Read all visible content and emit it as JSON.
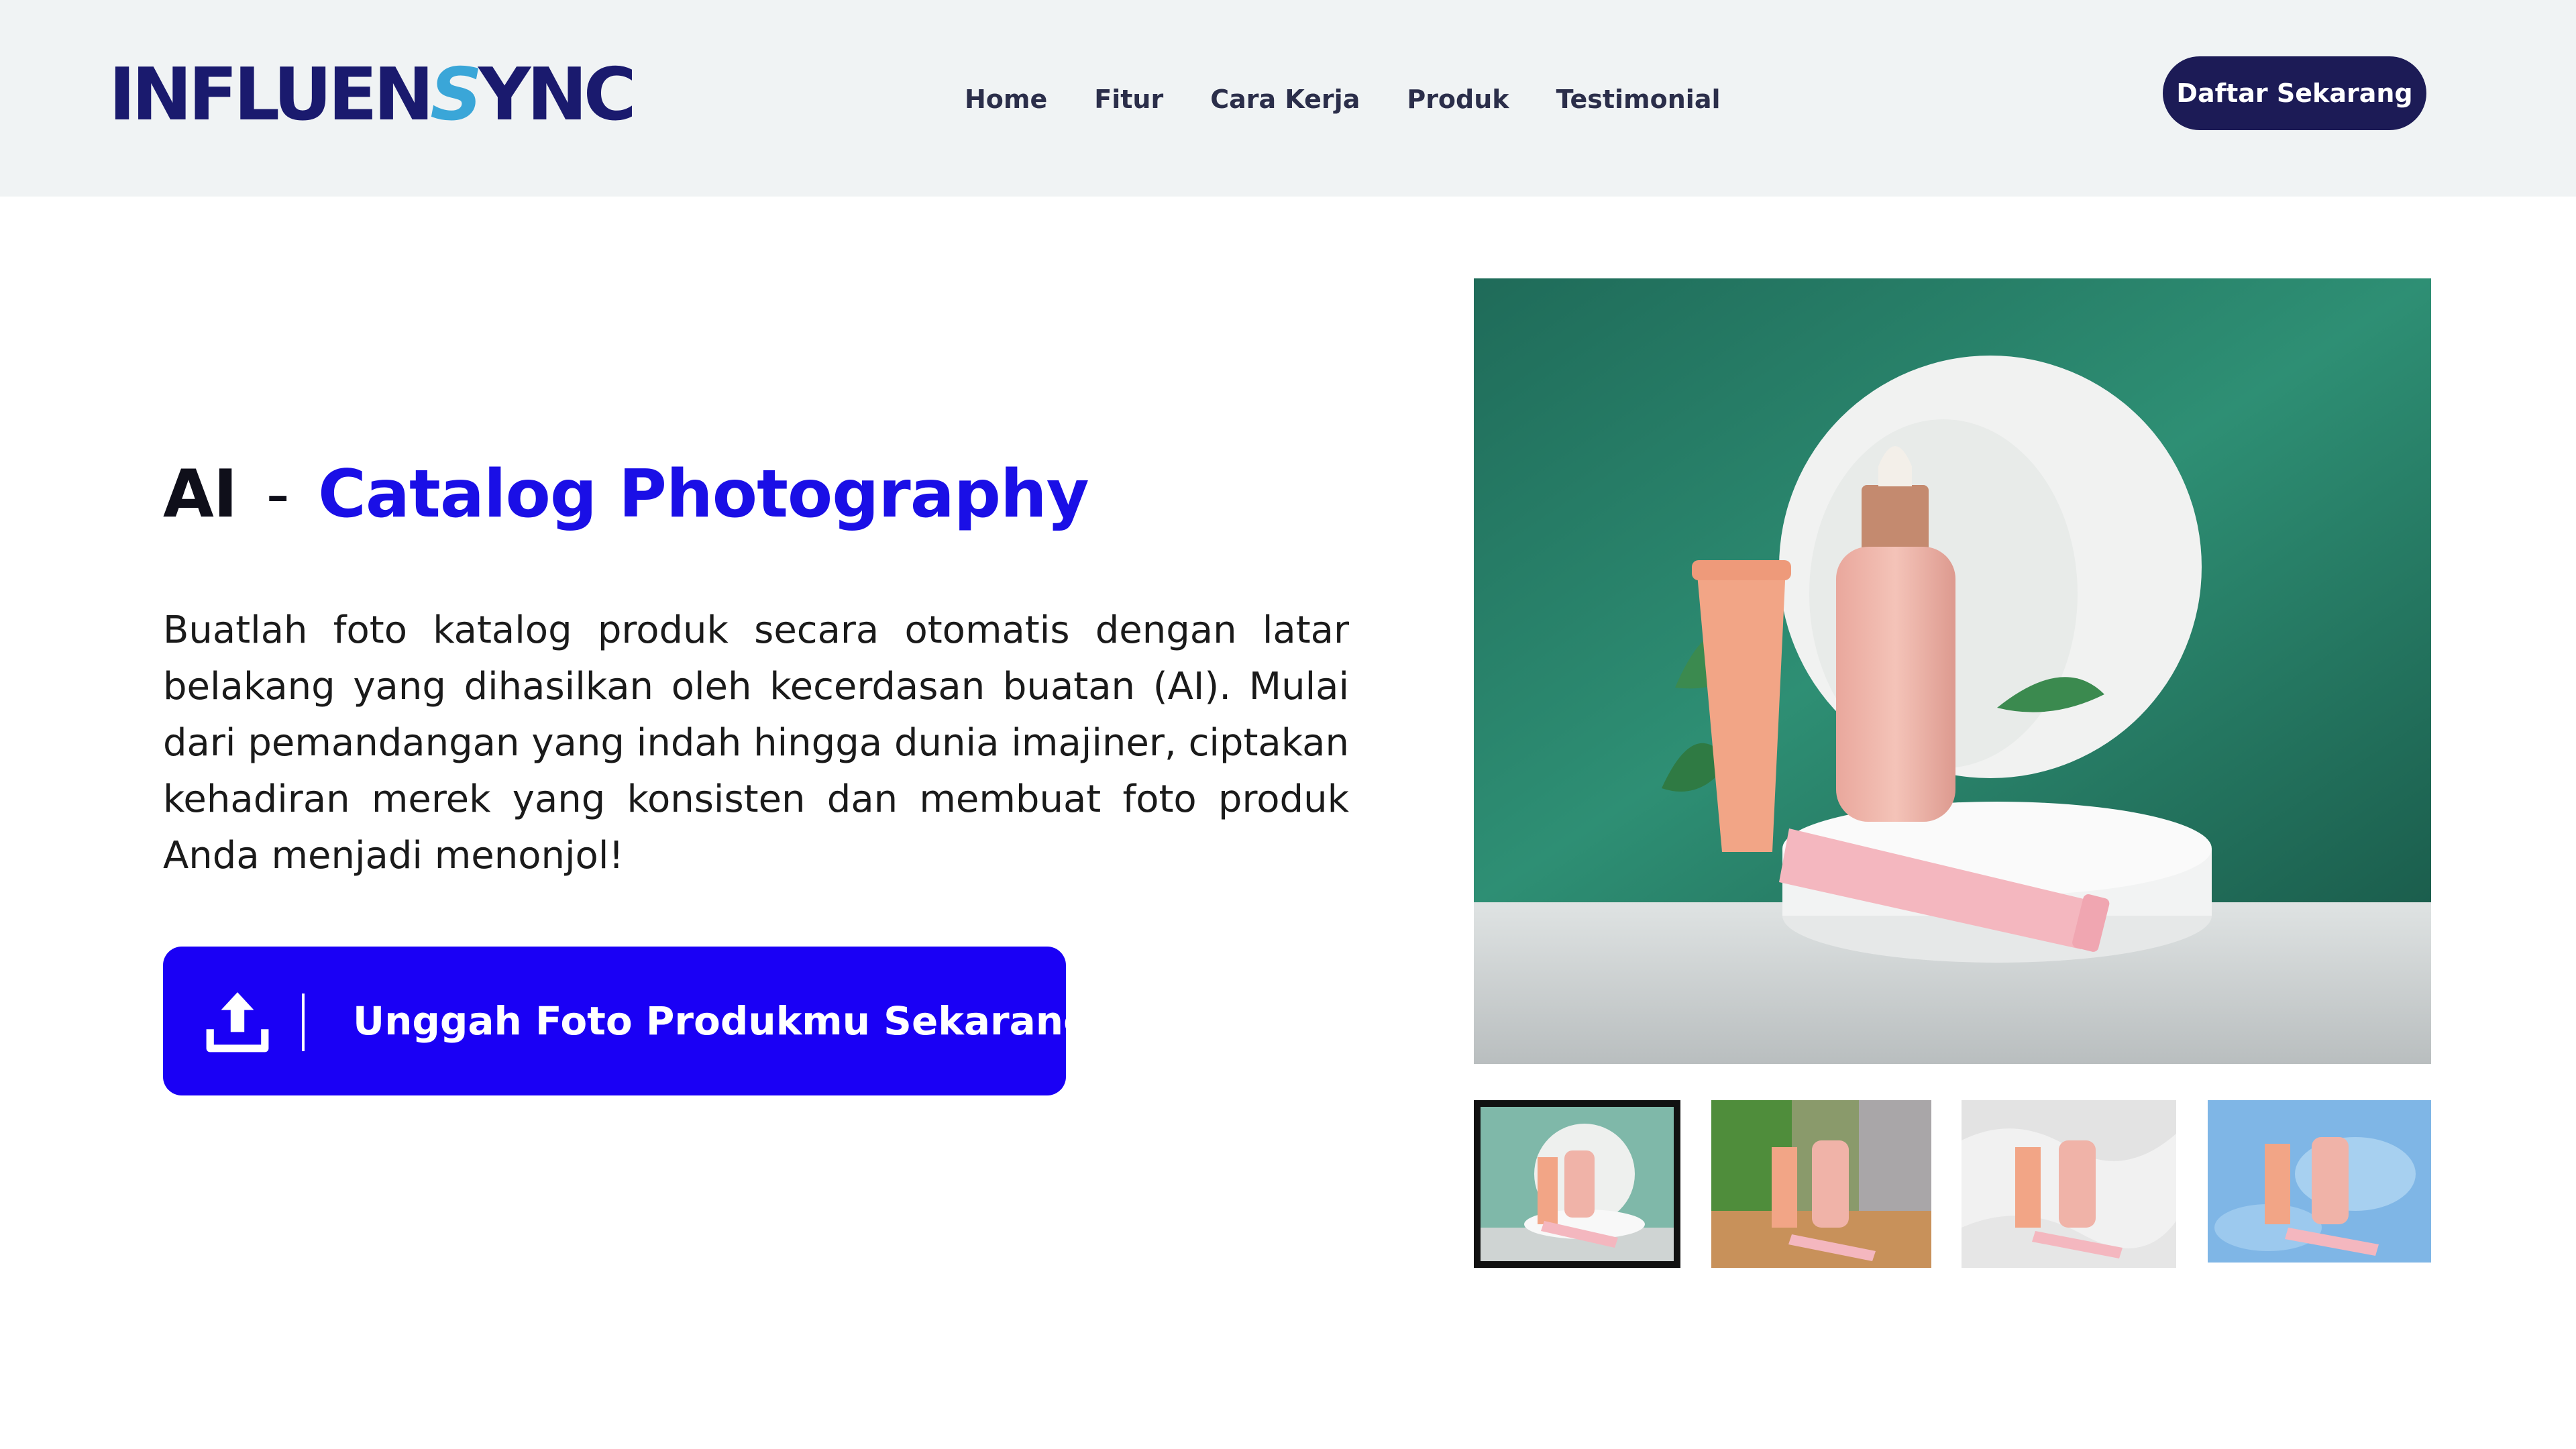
{
  "header": {
    "logo": {
      "part1": "INFLUEN",
      "part2": "S",
      "part3": "YNC"
    },
    "nav": [
      "Home",
      "Fitur",
      "Cara Kerja",
      "Produk",
      "Testimonial"
    ],
    "cta_label": "Daftar Sekarang"
  },
  "hero": {
    "title_prefix": "AI",
    "title_separator": "-",
    "title_highlight": "Catalog Photography",
    "description": "Buatlah foto katalog produk secara otomatis dengan latar belakang yang dihasilkan oleh kecerdasan buatan (AI). Mulai dari pemandangan yang indah hingga dunia imajiner, ciptakan kehadiran merek yang konsisten dan membuat foto produk Anda menjadi menonjol!",
    "upload_label": "Unggah Foto Produkmu Sekarang!",
    "upload_icon": "upload-icon"
  },
  "gallery": {
    "selected_index": 0,
    "thumbnails": [
      {
        "icon": "thumb-green-backdrop"
      },
      {
        "icon": "thumb-wooden-table"
      },
      {
        "icon": "thumb-white-cream"
      },
      {
        "icon": "thumb-blue-gel"
      }
    ]
  },
  "colors": {
    "brand_dark": "#1c1b56",
    "accent_blue": "#1a00f5",
    "headline_blue": "#1a0fe6",
    "navbar_bg": "#f0f3f4"
  }
}
